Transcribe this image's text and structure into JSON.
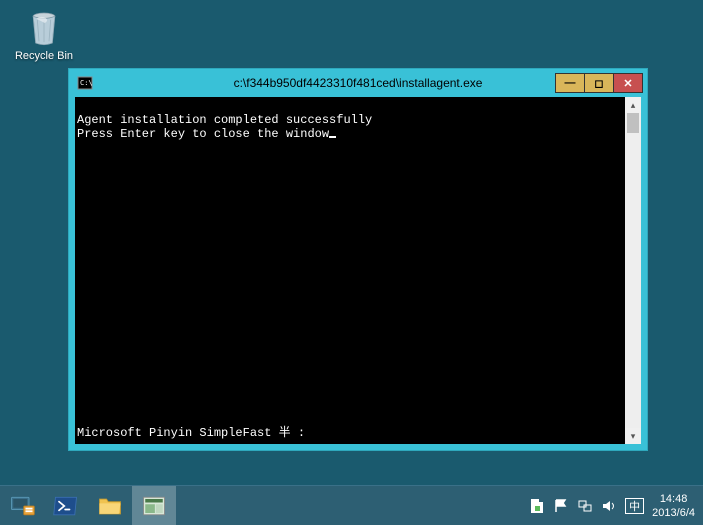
{
  "desktop": {
    "recycle_bin_label": "Recycle Bin"
  },
  "window": {
    "title": "c:\\f344b950df4423310f481ced\\installagent.exe",
    "buttons": {
      "min": "—",
      "max": "◻",
      "close": "✕"
    }
  },
  "console": {
    "line1": "Agent installation completed successfully",
    "line2": "Press Enter key to close the window",
    "status_line": "Microsoft Pinyin SimpleFast 半 :"
  },
  "systray": {
    "ime_text": "中"
  },
  "clock": {
    "time": "14:48",
    "date": "2013/6/4"
  }
}
